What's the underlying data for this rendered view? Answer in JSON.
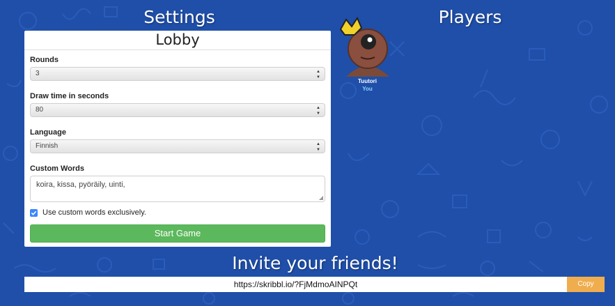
{
  "headings": {
    "settings": "Settings",
    "players": "Players",
    "invite": "Invite your friends!"
  },
  "lobby": {
    "title": "Lobby",
    "rounds_label": "Rounds",
    "rounds_value": "3",
    "draw_time_label": "Draw time in seconds",
    "draw_time_value": "80",
    "language_label": "Language",
    "language_value": "Finnish",
    "custom_words_label": "Custom Words",
    "custom_words_value": "koira, kissa, pyöräily, uinti,",
    "exclusive_label": "Use custom words exclusively.",
    "exclusive_checked": true,
    "start_label": "Start Game"
  },
  "player": {
    "name": "Tuutori",
    "tag": "You",
    "icon": "crown-icon"
  },
  "invite": {
    "link": "https://skribbl.io/?FjMdmoAINPQt",
    "copy_label": "Copy"
  },
  "colors": {
    "background": "#1f4fa8",
    "start_button": "#5cb85c",
    "copy_button": "#f0ad4e",
    "checkbox": "#3a86ff",
    "you_tag": "#8fd3ff"
  }
}
